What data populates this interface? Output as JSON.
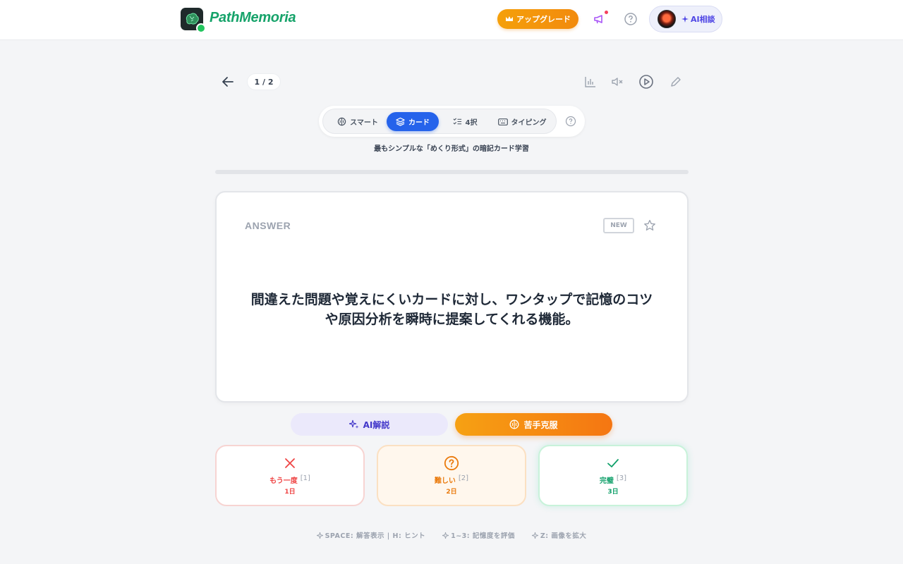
{
  "header": {
    "brand": "PathMemoria",
    "upgrade_label": "アップグレード",
    "ai_consult_label": "AI相談"
  },
  "toolbar": {
    "counter": "1 / 2"
  },
  "modes": {
    "tabs": [
      {
        "label": "スマート",
        "icon": "brain-icon"
      },
      {
        "label": "カード",
        "icon": "layers-icon",
        "active": true
      },
      {
        "label": "4択",
        "icon": "checklist-icon"
      },
      {
        "label": "タイピング",
        "icon": "keyboard-icon"
      }
    ],
    "description": "最もシンプルな「めくり形式」の暗記カード学習"
  },
  "card": {
    "label": "ANSWER",
    "badge": "NEW",
    "text": "間違えた問題や覚えにくいカードに対し、ワンタップで記憶のコツや原因分析を瞬時に提案してくれる機能。"
  },
  "actions": {
    "ai_explain": "AI解説",
    "overcome": "苦手克服"
  },
  "ratings": [
    {
      "label": "もう一度",
      "key": "[1]",
      "interval": "1日",
      "color": "#ef4444"
    },
    {
      "label": "難しい",
      "key": "[2]",
      "interval": "2日",
      "color": "#ea7a0c"
    },
    {
      "label": "完璧",
      "key": "[3]",
      "interval": "3日",
      "color": "#10a06a"
    }
  ],
  "shortcuts": [
    "SPACE: 解答表示 | H: ヒント",
    "1~3: 記憶度を評価",
    "Z: 画像を拡大"
  ],
  "colors": {
    "accent_blue": "#2563eb",
    "brand_green": "#16a36a",
    "upgrade_orange": "#f59e0b"
  }
}
